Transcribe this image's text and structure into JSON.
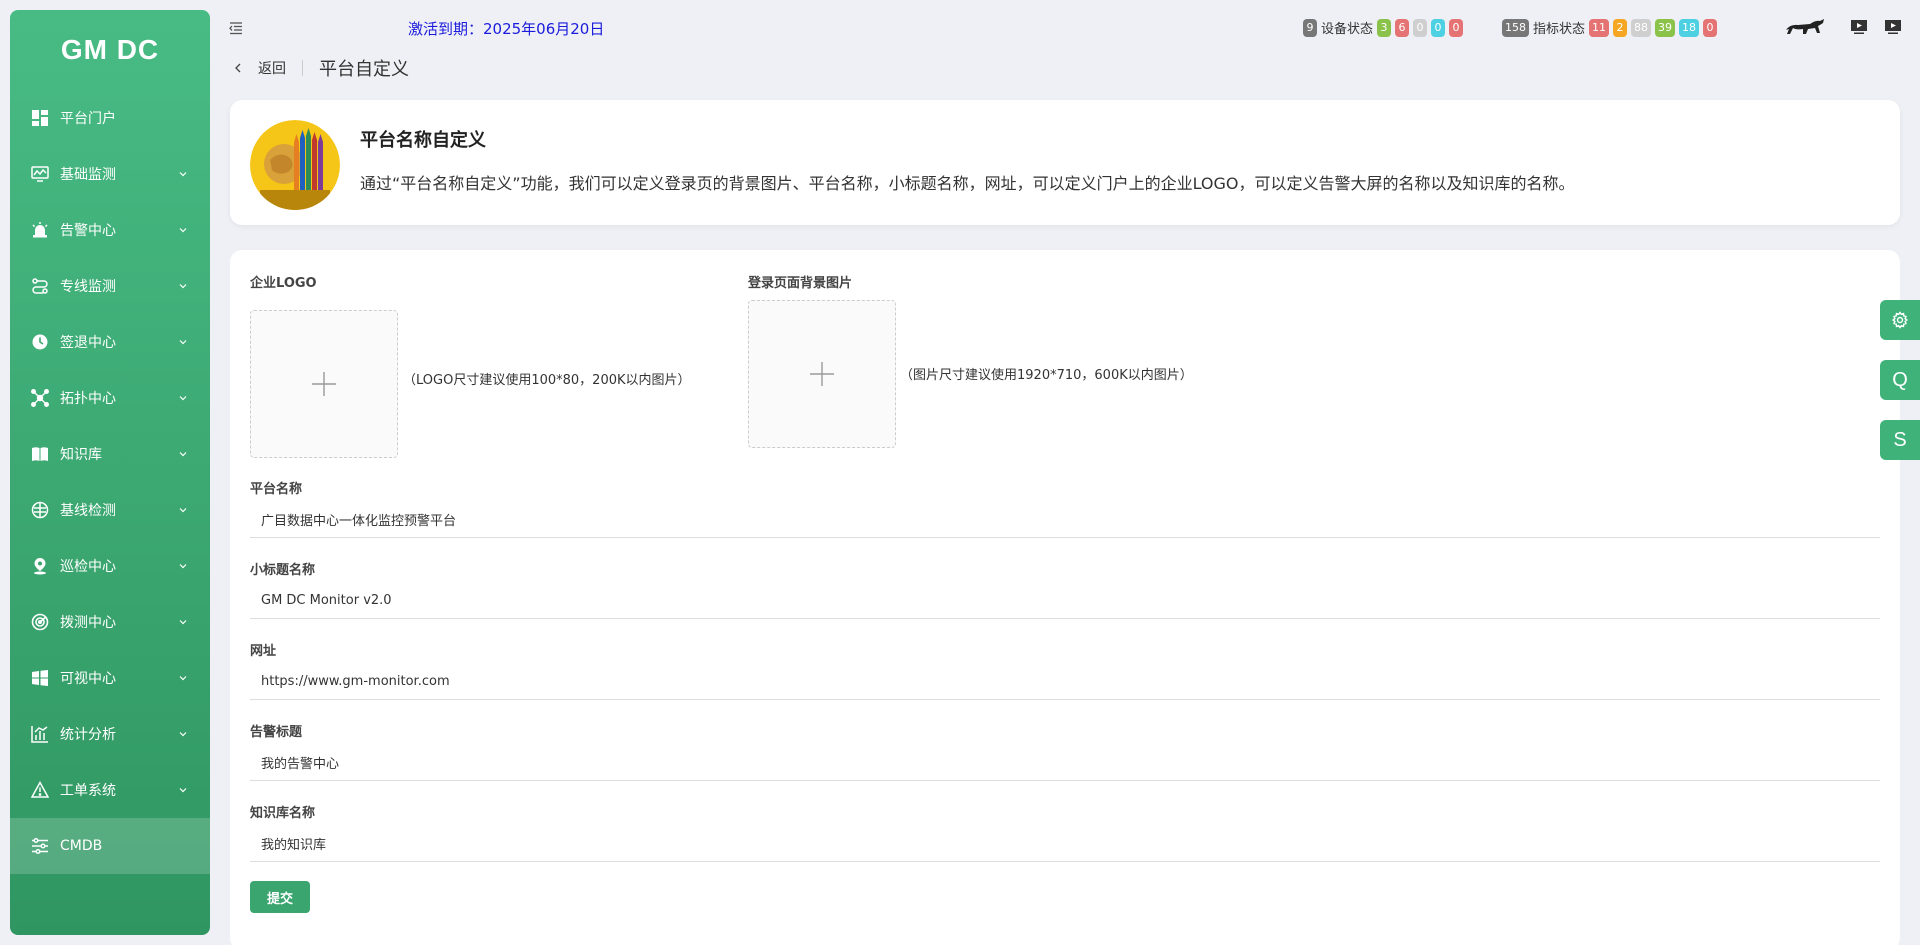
{
  "app": {
    "logo": "GM DC"
  },
  "sidebar": {
    "items": [
      {
        "label": "平台门户",
        "icon": "dashboard-icon",
        "has_arrow": false
      },
      {
        "label": "基础监测",
        "icon": "monitor-chart-icon",
        "has_arrow": true
      },
      {
        "label": "告警中心",
        "icon": "alarm-light-icon",
        "has_arrow": true
      },
      {
        "label": "专线监测",
        "icon": "route-icon",
        "has_arrow": true
      },
      {
        "label": "签退中心",
        "icon": "clock-icon",
        "has_arrow": true
      },
      {
        "label": "拓扑中心",
        "icon": "topology-icon",
        "has_arrow": true
      },
      {
        "label": "知识库",
        "icon": "book-icon",
        "has_arrow": true
      },
      {
        "label": "基线检测",
        "icon": "baseline-icon",
        "has_arrow": true
      },
      {
        "label": "巡检中心",
        "icon": "location-pin-icon",
        "has_arrow": true
      },
      {
        "label": "拨测中心",
        "icon": "radar-icon",
        "has_arrow": true
      },
      {
        "label": "可视中心",
        "icon": "windows-icon",
        "has_arrow": true
      },
      {
        "label": "统计分析",
        "icon": "bar-chart-icon",
        "has_arrow": true
      },
      {
        "label": "工单系统",
        "icon": "warning-icon",
        "has_arrow": true
      },
      {
        "label": "CMDB",
        "icon": "sliders-icon",
        "has_arrow": false,
        "active": true
      }
    ]
  },
  "header": {
    "activation": "激活到期：2025年06月20日",
    "device_status": {
      "total": "9",
      "label": "设备状态",
      "badges": [
        {
          "value": "3",
          "color": "#8bc34a"
        },
        {
          "value": "6",
          "color": "#e57373"
        },
        {
          "value": "0",
          "color": "#cfcfcf"
        },
        {
          "value": "0",
          "color": "#4dd0e1"
        },
        {
          "value": "0",
          "color": "#e57373"
        }
      ]
    },
    "metric_status": {
      "total": "158",
      "label": "指标状态",
      "badges": [
        {
          "value": "11",
          "color": "#e57373"
        },
        {
          "value": "2",
          "color": "#f5a623"
        },
        {
          "value": "88",
          "color": "#cfcfcf"
        },
        {
          "value": "39",
          "color": "#8bc34a"
        },
        {
          "value": "18",
          "color": "#4dd0e1"
        },
        {
          "value": "0",
          "color": "#e57373"
        }
      ]
    }
  },
  "breadcrumb": {
    "back": "返回",
    "title": "平台自定义"
  },
  "intro": {
    "title": "平台名称自定义",
    "description": "通过“平台名称自定义”功能，我们可以定义登录页的背景图片、平台名称，小标题名称，网址，可以定义门户上的企业LOGO，可以定义告警大屏的名称以及知识库的名称。"
  },
  "form": {
    "logo_label": "企业LOGO",
    "logo_hint": "（LOGO尺寸建议使用100*80，200K以内图片）",
    "bg_label": "登录页面背景图片",
    "bg_hint": "（图片尺寸建议使用1920*710，600K以内图片）",
    "platform_name_label": "平台名称",
    "platform_name_value": "广目数据中心一体化监控预警平台",
    "subtitle_label": "小标题名称",
    "subtitle_value": "GM DC Monitor v2.0",
    "url_label": "网址",
    "url_value": "https://www.gm-monitor.com",
    "alarm_title_label": "告警标题",
    "alarm_title_value": "我的告警中心",
    "kb_name_label": "知识库名称",
    "kb_name_value": "我的知识库",
    "submit": "提交"
  },
  "floating": {
    "q": "Q",
    "s": "S"
  },
  "colors": {
    "brand": "#3aa56f",
    "activation": "#1a1adc"
  }
}
